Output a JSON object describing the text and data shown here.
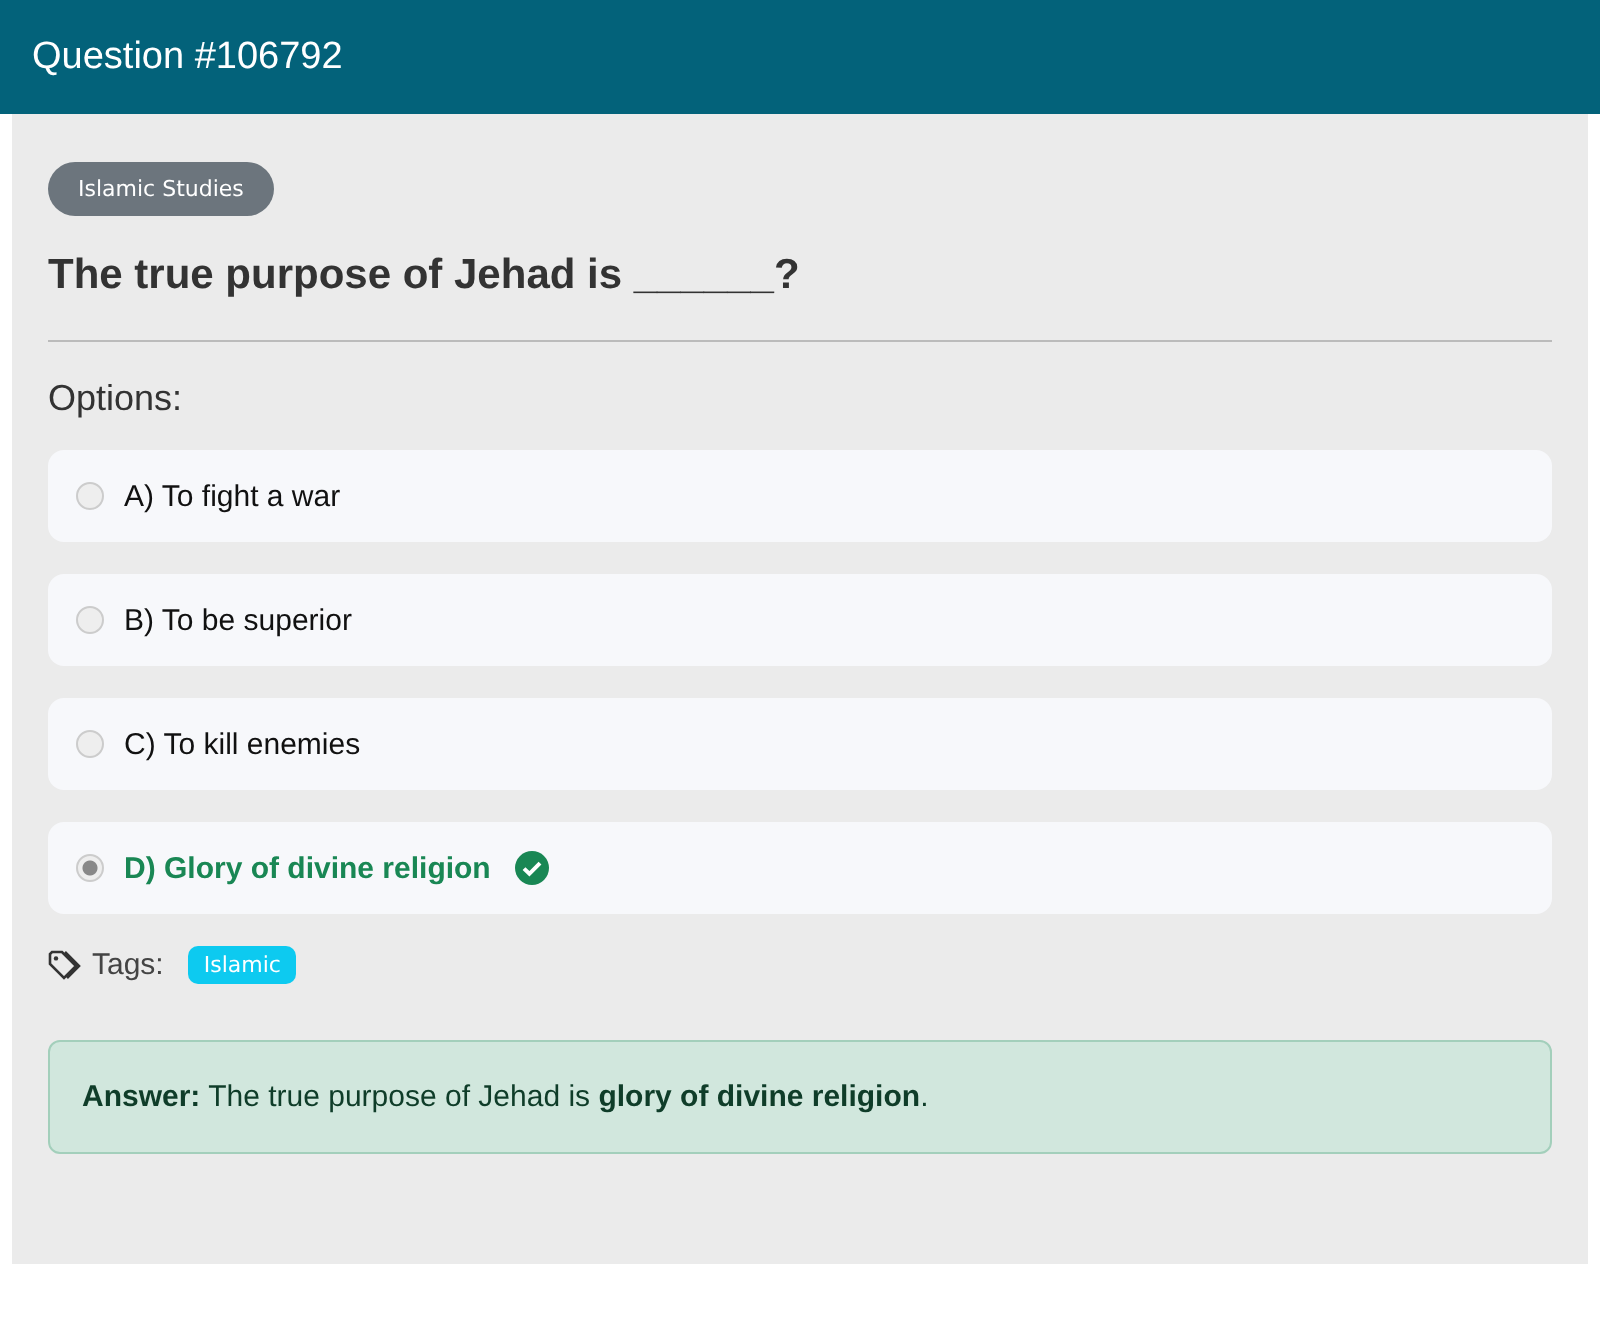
{
  "header": {
    "title": "Question #106792"
  },
  "category": "Islamic Studies",
  "question": "The true purpose of Jehad is ______?",
  "options_label": "Options:",
  "options": [
    {
      "text": "A) To fight a war",
      "selected": false,
      "correct": false
    },
    {
      "text": "B) To be superior",
      "selected": false,
      "correct": false
    },
    {
      "text": "C) To kill enemies",
      "selected": false,
      "correct": false
    },
    {
      "text": "D) Glory of divine religion",
      "selected": true,
      "correct": true
    }
  ],
  "tags_label": "Tags:",
  "tags": [
    "Islamic"
  ],
  "answer": "**Answer:** The true purpose of Jehad is **glory of divine religion**."
}
